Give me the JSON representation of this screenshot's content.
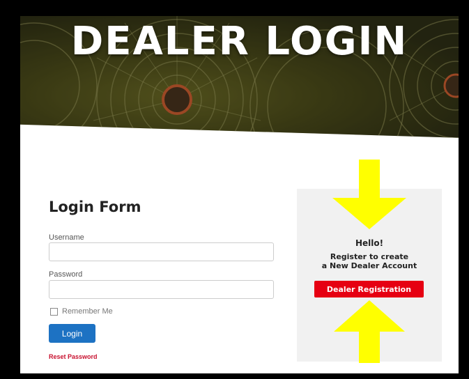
{
  "hero": {
    "title": "DEALER LOGIN"
  },
  "login_form": {
    "title": "Login Form",
    "username_label": "Username",
    "username_value": "",
    "password_label": "Password",
    "password_value": "",
    "remember_label": "Remember Me",
    "remember_checked": false,
    "login_button": "Login",
    "reset_link": "Reset Password"
  },
  "register_panel": {
    "hello": "Hello!",
    "line1": "Register to create",
    "line2": "a New Dealer Account",
    "button": "Dealer Registration",
    "arrow_icons": [
      "arrow-down-icon",
      "arrow-up-icon"
    ]
  },
  "colors": {
    "login_button": "#1d72c3",
    "registration_button": "#e60012",
    "reset_link": "#c8102e",
    "arrows": "#ffff00",
    "panel_background": "#f1f1f1"
  }
}
